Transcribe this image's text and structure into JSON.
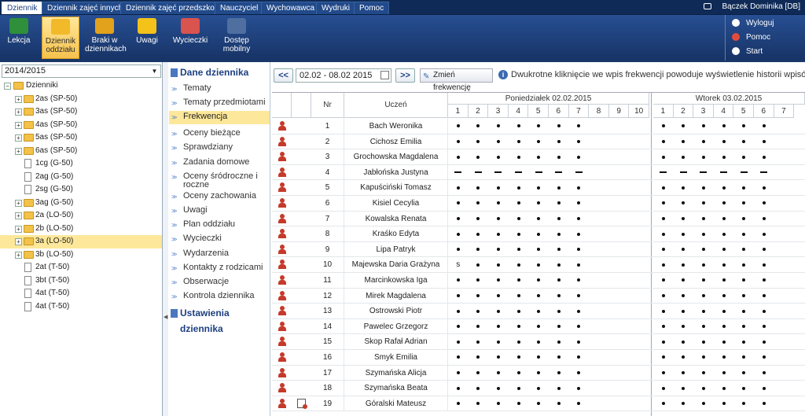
{
  "menubar": {
    "tabs": [
      "Dziennik",
      "Dziennik zajęć innych",
      "Dziennik zajęć przedszkola",
      "Nauczyciel",
      "Wychowawca",
      "Wydruki",
      "Pomoc"
    ],
    "active_tab": "Dziennik",
    "user": "Bączek Dominika [DB]"
  },
  "toolbar": {
    "buttons": [
      {
        "label": "Lekcja",
        "icon": "chalkboard-icon"
      },
      {
        "label": "Dziennik oddziału",
        "icon": "journal-icon"
      },
      {
        "label": "Braki w dziennikach",
        "icon": "warning-book-icon"
      },
      {
        "label": "Uwagi",
        "icon": "exclamation-icon"
      },
      {
        "label": "Wycieczki",
        "icon": "backpack-icon"
      },
      {
        "label": "Dostęp mobilny",
        "icon": "mobile-icon"
      }
    ],
    "right_links": [
      {
        "label": "Wyloguj",
        "icon": "lock-icon"
      },
      {
        "label": "Pomoc",
        "icon": "lifebuoy-icon"
      },
      {
        "label": "Start",
        "icon": "home-icon"
      }
    ]
  },
  "left": {
    "year": "2014/2015",
    "root": "Dzienniki",
    "items": [
      {
        "label": "2as (SP-50)",
        "type": "folder",
        "selected": false
      },
      {
        "label": "3as (SP-50)",
        "type": "folder",
        "selected": false
      },
      {
        "label": "4as (SP-50)",
        "type": "folder",
        "selected": false
      },
      {
        "label": "5as (SP-50)",
        "type": "folder",
        "selected": false
      },
      {
        "label": "6as (SP-50)",
        "type": "folder",
        "selected": false
      },
      {
        "label": "1cg (G-50)",
        "type": "doc",
        "selected": false
      },
      {
        "label": "2ag (G-50)",
        "type": "doc",
        "selected": false
      },
      {
        "label": "2sg (G-50)",
        "type": "doc",
        "selected": false
      },
      {
        "label": "3ag (G-50)",
        "type": "folder",
        "selected": false
      },
      {
        "label": "2a (LO-50)",
        "type": "folder",
        "selected": false
      },
      {
        "label": "2b (LO-50)",
        "type": "folder",
        "selected": false
      },
      {
        "label": "3a (LO-50)",
        "type": "folder",
        "selected": true
      },
      {
        "label": "3b (LO-50)",
        "type": "folder",
        "selected": false
      },
      {
        "label": "2at (T-50)",
        "type": "doc",
        "selected": false
      },
      {
        "label": "3bt (T-50)",
        "type": "doc",
        "selected": false
      },
      {
        "label": "4at (T-50)",
        "type": "doc",
        "selected": false
      },
      {
        "label": "4at (T-50)",
        "type": "doc",
        "selected": false
      }
    ]
  },
  "middle": {
    "section1": "Dane dziennika",
    "items": [
      "Tematy",
      "Tematy przedmiotami",
      "Frekwencja",
      "Oceny bieżące",
      "Sprawdziany",
      "Zadania domowe",
      "Oceny śródroczne i roczne",
      "Oceny zachowania",
      "Uwagi",
      "Plan oddziału",
      "Wycieczki",
      "Wydarzenia",
      "Kontakty z rodzicami",
      "Obserwacje",
      "Kontrola dziennika"
    ],
    "selected": "Frekwencja",
    "section2": "Ustawienia dziennika"
  },
  "main": {
    "prev": "<<",
    "next": ">>",
    "date_range": "02.02 - 08.02 2015",
    "change_button": "Zmień frekwencję",
    "info": "Dwukrotne kliknięcie we wpis frekwencji powoduje wyświetlenie historii wpisów",
    "col_nr": "Nr",
    "col_student": "Uczeń",
    "days": [
      {
        "label": "Poniedziałek 02.02.2015",
        "lessons": [
          "1",
          "2",
          "3",
          "4",
          "5",
          "6",
          "7",
          "8",
          "9",
          "10"
        ]
      },
      {
        "label": "Wtorek 03.02.2015",
        "lessons": [
          "1",
          "2",
          "3",
          "4",
          "5",
          "6",
          "7"
        ]
      }
    ],
    "students": [
      {
        "nr": "1",
        "name": "Bach Weronika",
        "note": false,
        "mon": ".......",
        "tue": "......"
      },
      {
        "nr": "2",
        "name": "Cichosz Emilia",
        "note": false,
        "mon": ".......",
        "tue": "......"
      },
      {
        "nr": "3",
        "name": "Grochowska Magdalena",
        "note": false,
        "mon": ".......",
        "tue": "......"
      },
      {
        "nr": "4",
        "name": "Jabłońska Justyna",
        "note": false,
        "mon": "-------",
        "tue": "------"
      },
      {
        "nr": "5",
        "name": "Kapuściński Tomasz",
        "note": false,
        "mon": ".......",
        "tue": "......"
      },
      {
        "nr": "6",
        "name": "Kisiel Cecylia",
        "note": false,
        "mon": ".......",
        "tue": "......"
      },
      {
        "nr": "7",
        "name": "Kowalska Renata",
        "note": false,
        "mon": ".......",
        "tue": "......"
      },
      {
        "nr": "8",
        "name": "Kraśko Edyta",
        "note": false,
        "mon": ".......",
        "tue": "......"
      },
      {
        "nr": "9",
        "name": "Lipa Patryk",
        "note": false,
        "mon": ".......",
        "tue": "......"
      },
      {
        "nr": "10",
        "name": "Majewska Daria Grażyna",
        "note": false,
        "mon": "s......",
        "tue": "......"
      },
      {
        "nr": "11",
        "name": "Marcinkowska Iga",
        "note": false,
        "mon": ".......",
        "tue": "......"
      },
      {
        "nr": "12",
        "name": "Mirek Magdalena",
        "note": false,
        "mon": ".......",
        "tue": "......"
      },
      {
        "nr": "13",
        "name": "Ostrowski Piotr",
        "note": false,
        "mon": ".......",
        "tue": "......"
      },
      {
        "nr": "14",
        "name": "Pawelec Grzegorz",
        "note": false,
        "mon": ".......",
        "tue": "......"
      },
      {
        "nr": "15",
        "name": "Skop Rafał Adrian",
        "note": false,
        "mon": ".......",
        "tue": "......"
      },
      {
        "nr": "16",
        "name": "Smyk Emilia",
        "note": false,
        "mon": ".......",
        "tue": "......"
      },
      {
        "nr": "17",
        "name": "Szymańska Alicja",
        "note": false,
        "mon": ".......",
        "tue": "......"
      },
      {
        "nr": "18",
        "name": "Szymańska Beata",
        "note": false,
        "mon": ".......",
        "tue": "......"
      },
      {
        "nr": "19",
        "name": "Góralski Mateusz",
        "note": true,
        "mon": ".......",
        "tue": "......"
      }
    ]
  }
}
